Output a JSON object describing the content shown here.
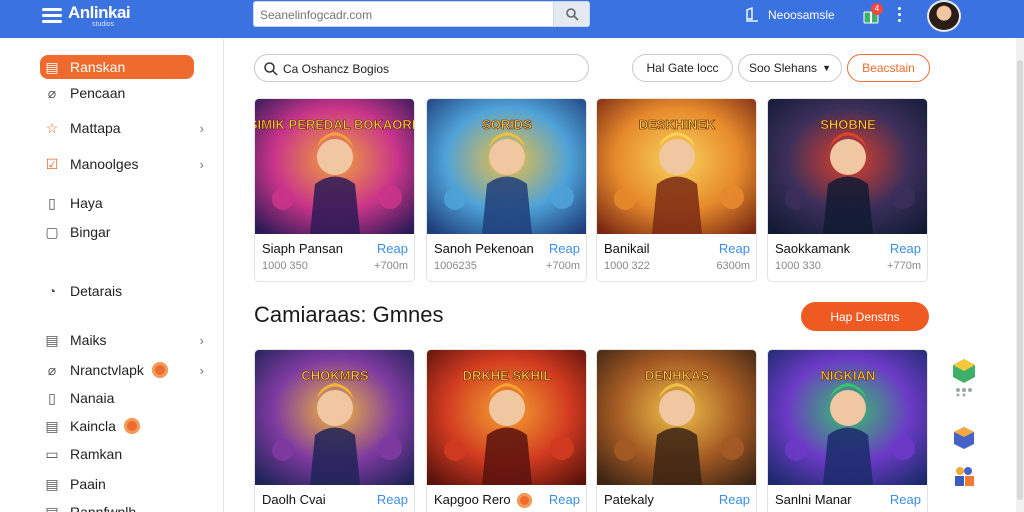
{
  "app": {
    "logo": "Anlinkai",
    "logo_sub": "studios",
    "search_placeholder": "Seanelinfogcadr.com",
    "account_link": "Neoosamsle",
    "gift_count": "4"
  },
  "sidebar": {
    "items": [
      {
        "label": "Ranskan",
        "active": true
      },
      {
        "label": "Pencaan"
      },
      {
        "label": "Mattapa",
        "chevron": true
      },
      {
        "label": "Manoolges",
        "chevron": true
      },
      {
        "label": "Haya"
      },
      {
        "label": "Bingar"
      },
      {
        "label": "Detarais"
      },
      {
        "label": "Maiks",
        "chevron": true
      },
      {
        "label": "Nranctvlapk",
        "chevron": true,
        "badge": true
      },
      {
        "label": "Nanaia"
      },
      {
        "label": "Kaincla",
        "badge": true
      },
      {
        "label": "Ramkan"
      },
      {
        "label": "Paain"
      },
      {
        "label": "Rannfwnlh"
      }
    ]
  },
  "toolbar": {
    "search_value": "Ca Oshancz Bogios",
    "filter1": "Hal Gate locc",
    "filter2": "Soo Slehans",
    "filter3": "Beacstain"
  },
  "featured": [
    {
      "title": "SIMIK PEREDAL BOKAORN",
      "name": "Siaph Pansan",
      "action": "Reap",
      "meta": "1000 350",
      "price": "+700m",
      "colors": [
        "#2b1a56",
        "#c9348a",
        "#f2a33a"
      ]
    },
    {
      "title": "SORIDS",
      "name": "Sanoh Pekenoan",
      "action": "Reap",
      "meta": "1006235",
      "price": "+700m",
      "colors": [
        "#1f3e7a",
        "#4ea2d8",
        "#f0c040"
      ]
    },
    {
      "title": "DESKHINEK",
      "name": "Banikail",
      "action": "Reap",
      "meta": "1000 322",
      "price": "6300m",
      "colors": [
        "#7a2a14",
        "#e78a2c",
        "#f9d35a"
      ]
    },
    {
      "title": "SHOBNE",
      "name": "Saokkamank",
      "action": "Reap",
      "meta": "1000 330",
      "price": "+770m",
      "colors": [
        "#111a33",
        "#3b2f5a",
        "#e0402a"
      ]
    }
  ],
  "section": {
    "title": "Camiaraas: Gmnes",
    "button": "Hap Denstns"
  },
  "games": [
    {
      "title": "CHOKMRS",
      "name": "Daolh Cvai",
      "action": "Reap",
      "colors": [
        "#1e2358",
        "#7e3aa0",
        "#f2b63c"
      ]
    },
    {
      "title": "DRKHE SKHIL",
      "name": "Kapgoo Rero",
      "action": "Reap",
      "badge": true,
      "colors": [
        "#5a120d",
        "#d23b20",
        "#f5a431"
      ]
    },
    {
      "title": "DENHKAS",
      "name": "Patekaly",
      "action": "Reap",
      "colors": [
        "#3b2414",
        "#a45a23",
        "#f0c24a"
      ]
    },
    {
      "title": "NIGKIAN",
      "name": "Sanlni Manar",
      "action": "Reap",
      "colors": [
        "#1b2a6b",
        "#6b3ac6",
        "#35c46a"
      ]
    }
  ],
  "icons": {
    "menu": "menu-icon",
    "search": "search-icon",
    "notify": "bell-icon",
    "gift": "gift-icon",
    "more": "more-vertical-icon"
  }
}
